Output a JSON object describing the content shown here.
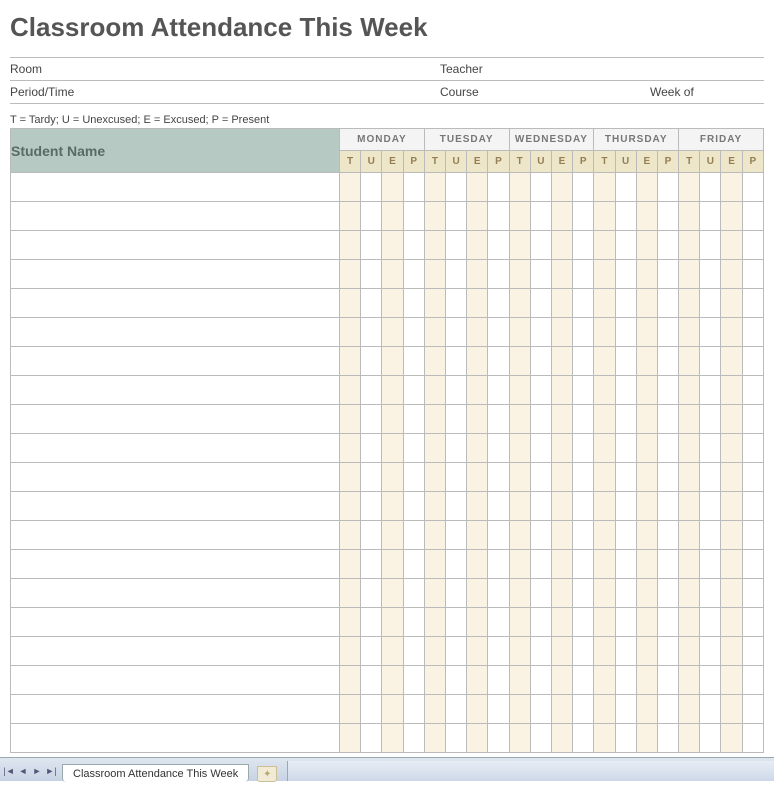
{
  "title": "Classroom Attendance This Week",
  "meta": {
    "room_label": "Room",
    "teacher_label": "Teacher",
    "period_label": "Period/Time",
    "course_label": "Course",
    "weekof_label": "Week of",
    "room_value": "",
    "teacher_value": "",
    "period_value": "",
    "course_value": "",
    "weekof_value": ""
  },
  "legend": "T = Tardy; U = Unexcused; E = Excused; P = Present",
  "table": {
    "student_header": "Student Name",
    "days": [
      "MONDAY",
      "TUESDAY",
      "WEDNESDAY",
      "THURSDAY",
      "FRIDAY"
    ],
    "codes": [
      "T",
      "U",
      "E",
      "P"
    ],
    "row_count": 20
  },
  "sheet_tab": "Classroom Attendance This Week"
}
